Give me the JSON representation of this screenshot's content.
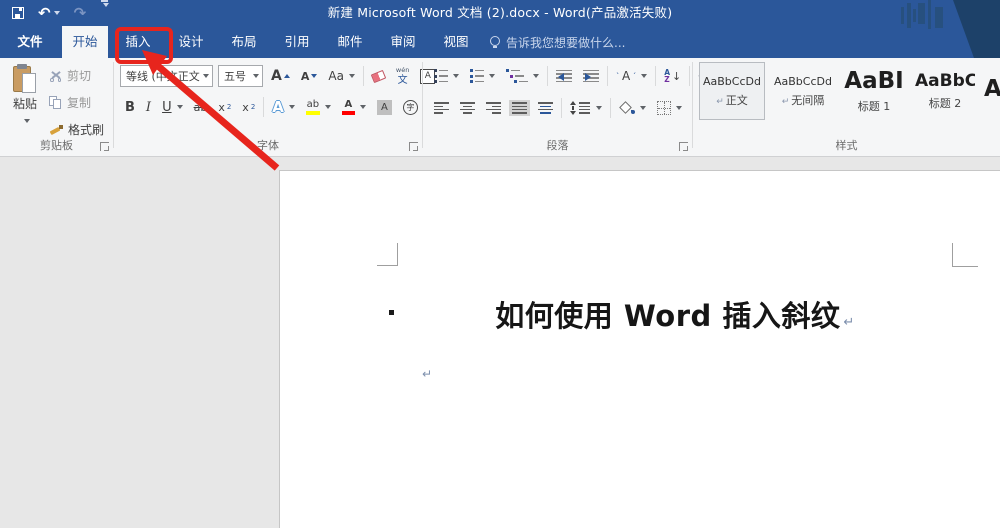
{
  "title_bar": {
    "title": "新建 Microsoft Word 文档 (2).docx - Word(产品激活失败)"
  },
  "qat": {
    "undo_glyph": "↶",
    "redo_glyph": "↷"
  },
  "tabs": {
    "file": "文件",
    "items": [
      "开始",
      "插入",
      "设计",
      "布局",
      "引用",
      "邮件",
      "审阅",
      "视图"
    ],
    "active": "开始",
    "highlighted": "插入",
    "tell_me": "告诉我您想要做什么..."
  },
  "ribbon": {
    "clipboard": {
      "group": "剪贴板",
      "paste": "粘贴",
      "cut": "剪切",
      "copy": "复制",
      "format_painter": "格式刷"
    },
    "font": {
      "group": "字体",
      "name": "等线 (中文正文)",
      "size": "五号",
      "grow": "A",
      "shrink": "A",
      "change_case": "Aa",
      "phonetic_top": "wén",
      "phonetic": "文",
      "char_border": "A",
      "bold": "B",
      "italic": "I",
      "underline": "U",
      "strike": "ab",
      "sub_base": "x",
      "sub": "2",
      "sup_base": "x",
      "sup": "2",
      "effects": "A",
      "highlight": "ab",
      "font_color": "A",
      "char_shading": "A",
      "enclose": "字"
    },
    "paragraph": {
      "group": "段落",
      "sort_a": "A",
      "sort_z": "Z",
      "show_mark": "↵",
      "asian": "A"
    },
    "styles": {
      "group": "样式",
      "items": [
        {
          "sample": "AaBbCcDd",
          "marker": "↵",
          "name": "正文"
        },
        {
          "sample": "AaBbCcDd",
          "marker": "↵",
          "name": "无间隔"
        },
        {
          "sample": "AaBI",
          "marker": "",
          "name": "标题 1"
        },
        {
          "sample": "AaBbC",
          "marker": "",
          "name": "标题 2"
        },
        {
          "sample": "A",
          "marker": "",
          "name": ""
        }
      ]
    }
  },
  "document": {
    "heading": "如何使用 Word 插入斜纹",
    "paragraph_mark": "↵",
    "colors": {
      "accent_red": "#e7251d",
      "title_blue": "#2b579a"
    }
  }
}
